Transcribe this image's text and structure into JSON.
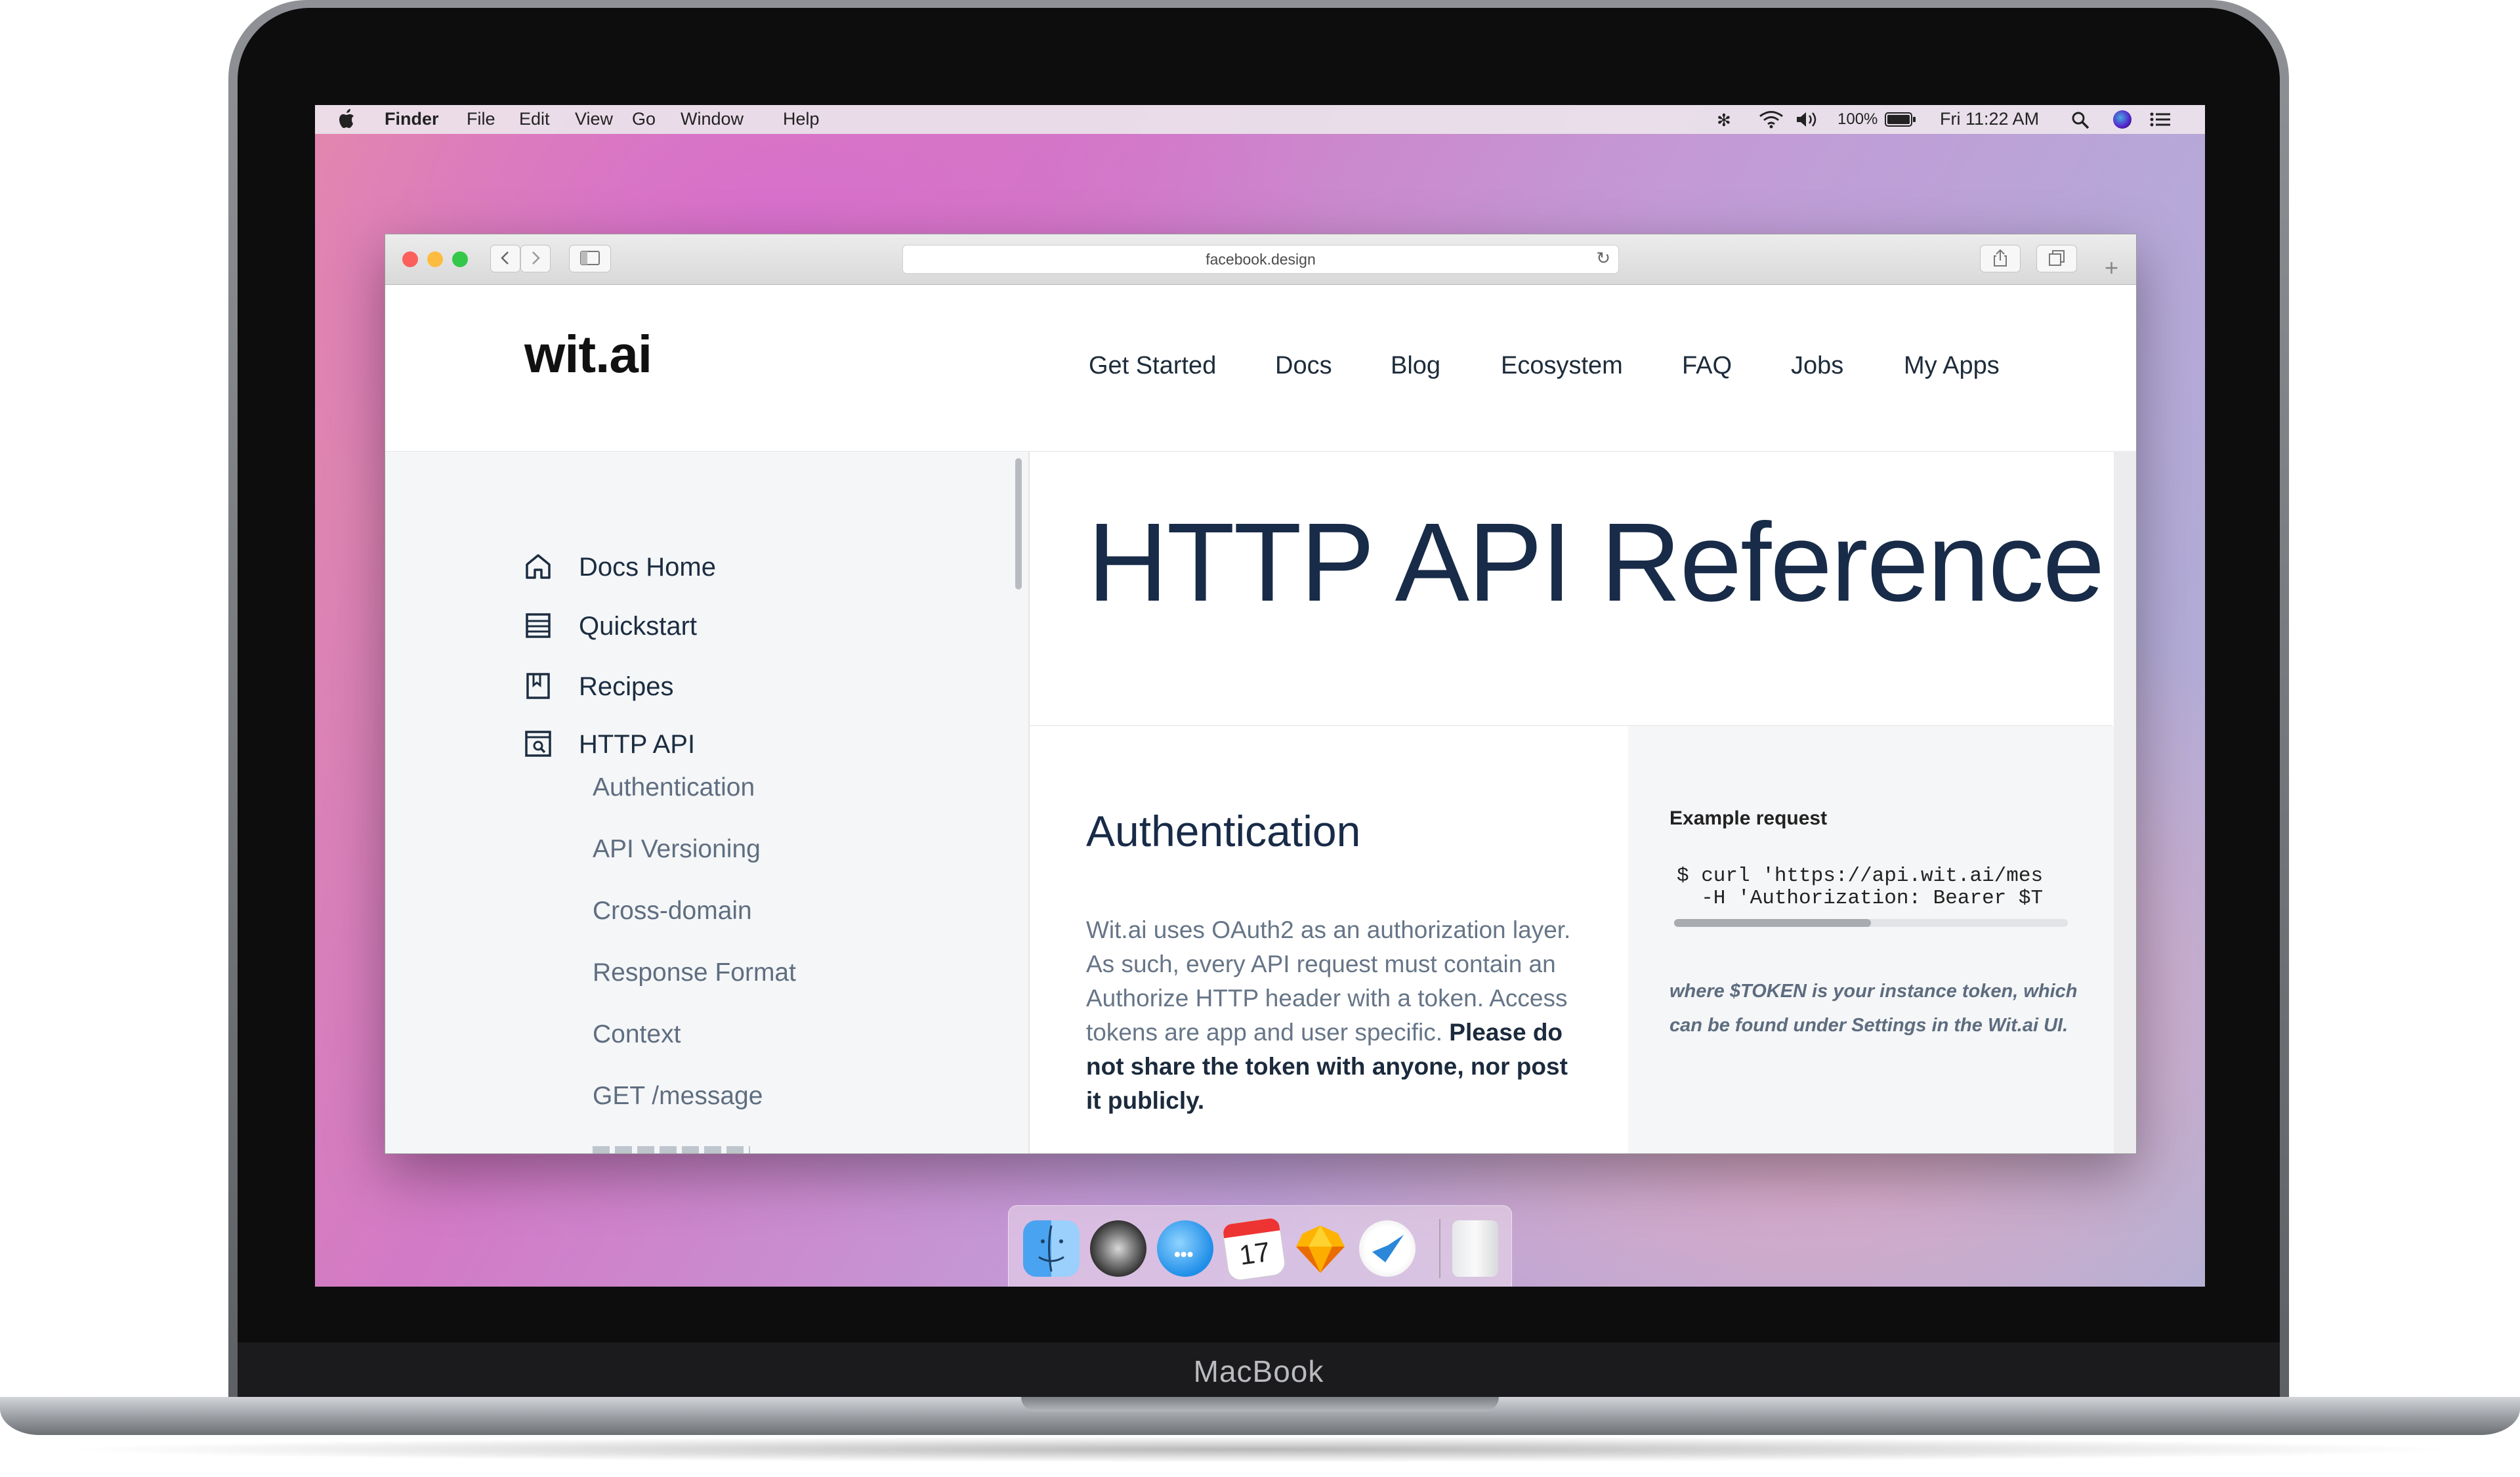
{
  "device": {
    "brand": "MacBook"
  },
  "menubar": {
    "apple_icon": "apple-icon",
    "app_name": "Finder",
    "menus": [
      "File",
      "Edit",
      "View",
      "Go",
      "Window",
      "Help"
    ],
    "battery_text": "100%",
    "clock": "Fri 11:22 AM",
    "status_icons": [
      "bluetooth-icon",
      "wifi-icon",
      "volume-icon",
      "battery-icon",
      "spotlight-icon",
      "siri-icon",
      "notification-center-icon"
    ]
  },
  "browser": {
    "url": "facebook.design",
    "traffic_light_colors": [
      "#fc605c",
      "#fdbc40",
      "#34c84a"
    ]
  },
  "site": {
    "logo": "wit.ai",
    "nav": [
      "Get Started",
      "Docs",
      "Blog",
      "Ecosystem",
      "FAQ",
      "Jobs",
      "My Apps"
    ]
  },
  "sidebar": {
    "items": [
      {
        "label": "Docs Home",
        "icon": "home-icon"
      },
      {
        "label": "Quickstart",
        "icon": "list-icon"
      },
      {
        "label": "Recipes",
        "icon": "book-icon"
      },
      {
        "label": "HTTP API",
        "icon": "api-search-icon"
      }
    ],
    "sub_items": [
      "Authentication",
      "API Versioning",
      "Cross-domain",
      "Response Format",
      "Context",
      "GET /message"
    ]
  },
  "main": {
    "title": "HTTP API Reference",
    "section_title": "Authentication",
    "paragraph": "Wit.ai uses OAuth2 as an authorization layer. As such, every API request must contain an Authorize HTTP header with a token. Access tokens are app and user specific.",
    "paragraph_bold": "Please do not share the token with anyone, nor post it publicly."
  },
  "aside": {
    "label": "Example request",
    "code_line1": "$ curl 'https://api.wit.ai/mes",
    "code_line2": "  -H 'Authorization: Bearer $T",
    "note": "where $TOKEN is your instance token, which can be found under Settings in the Wit.ai UI."
  },
  "dock": {
    "apps": [
      "finder-icon",
      "system-preferences-icon",
      "messages-icon",
      "calendar-icon",
      "sketch-icon",
      "wunderlist-icon",
      "trash-icon"
    ],
    "calendar_day": "17"
  }
}
